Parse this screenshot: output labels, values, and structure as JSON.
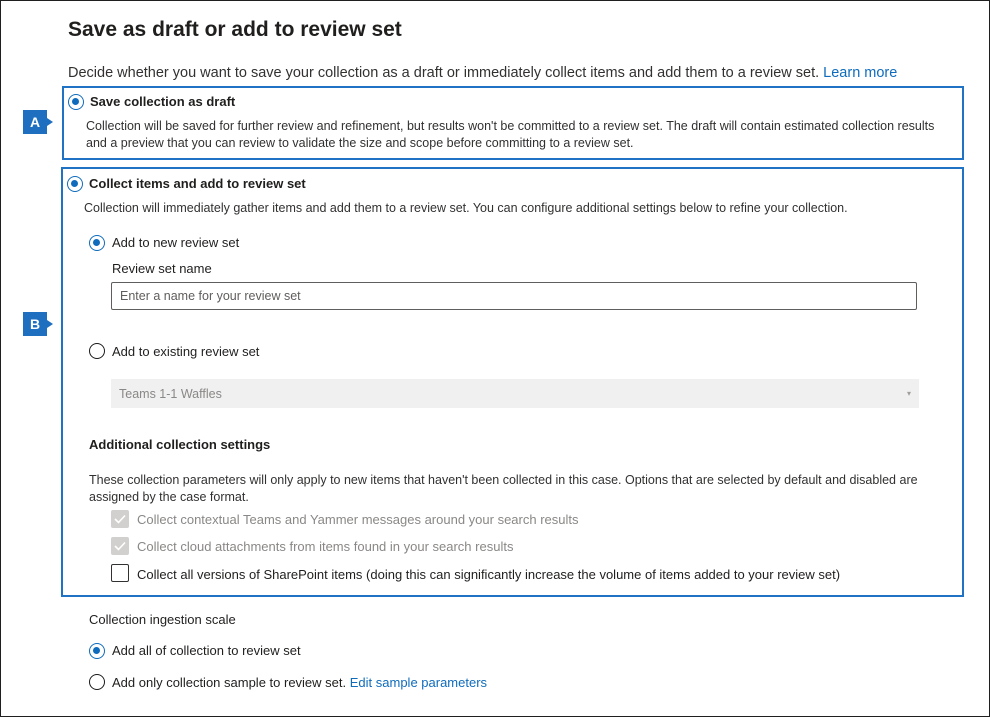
{
  "header": {
    "title": "Save as draft or add to review set",
    "description": "Decide whether you want to save your collection as a draft or immediately collect items and add them to a review set.",
    "learn_more": "Learn more"
  },
  "callouts": {
    "a": "A",
    "b": "B"
  },
  "draft_option": {
    "label": "Save collection as draft",
    "selected": true,
    "description_line1": "Collection will be saved for further review and refinement, but results won't be committed to a review set. The draft will contain estimated collection results",
    "description_line2": "and a preview that you can review to validate the size and scope before committing to a review set."
  },
  "collect_option": {
    "label": "Collect items and add to review set",
    "selected": true,
    "description": "Collection will immediately gather items and add them to a review set. You can configure additional settings below to refine your collection."
  },
  "new_review_set": {
    "label": "Add to new review set",
    "selected": true,
    "field_label": "Review set name",
    "value": "",
    "placeholder": "Enter a name for your review set"
  },
  "existing_review_set": {
    "label": "Add to existing review set",
    "selected": false,
    "selected_value": "Teams 1-1 Waffles"
  },
  "additional_settings": {
    "heading": "Additional collection settings",
    "description_line1": "These collection parameters will only apply to new items that haven't been collected in this case. Options that are selected by default and disabled are",
    "description_line2": "assigned by the case format.",
    "options": [
      {
        "label": "Collect contextual Teams and Yammer messages around your search results",
        "checked": true,
        "disabled": true
      },
      {
        "label": "Collect cloud attachments from items found in your search results",
        "checked": true,
        "disabled": true
      },
      {
        "label": "Collect all versions of SharePoint items (doing this can significantly increase the volume of items added to your review set)",
        "checked": false,
        "disabled": false
      }
    ]
  },
  "ingestion_scale": {
    "heading": "Collection ingestion scale",
    "options": [
      {
        "label": "Add all of collection to review set",
        "selected": true
      },
      {
        "label": "Add only collection sample to review set.",
        "selected": false,
        "link": "Edit sample parameters"
      }
    ]
  },
  "colors": {
    "accent": "#0f6cbd",
    "callout": "#1f6fc0",
    "border": "#1f72c4"
  }
}
